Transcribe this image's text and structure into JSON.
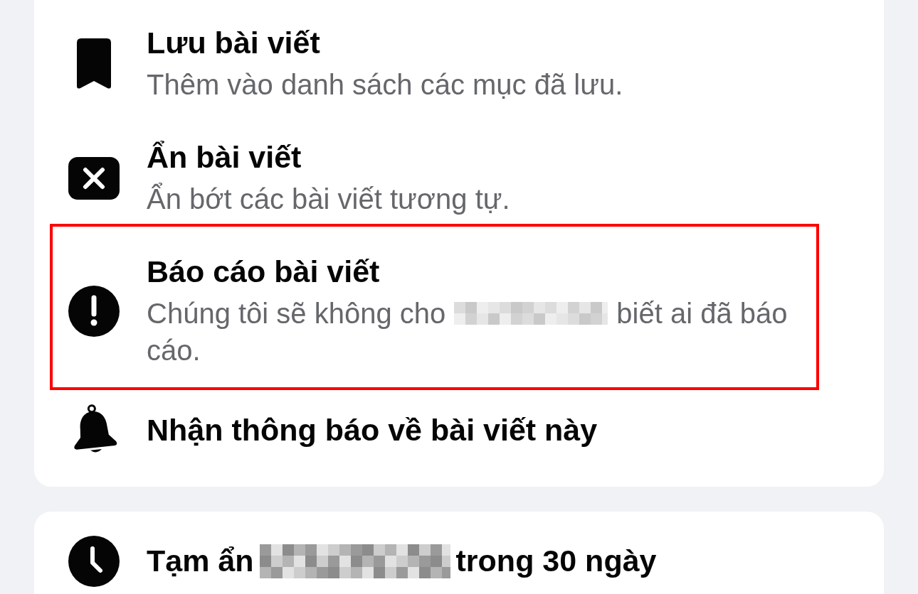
{
  "cards": [
    {
      "items": [
        {
          "title": [
            {
              "kind": "text",
              "text": "Lưu bài viết"
            }
          ],
          "description": [
            {
              "kind": "text",
              "text": "Thêm vào danh sách các mục đã lưu."
            }
          ],
          "highlighted": false
        },
        {
          "title": [
            {
              "kind": "text",
              "text": "Ẩn bài viết"
            }
          ],
          "description": [
            {
              "kind": "text",
              "text": "Ẩn bớt các bài viết tương tự."
            }
          ],
          "highlighted": false
        },
        {
          "title": [
            {
              "kind": "text",
              "text": "Báo cáo bài viết"
            }
          ],
          "description": [
            {
              "kind": "text",
              "text": "Chúng tôi sẽ không cho"
            },
            {
              "kind": "redacted"
            },
            {
              "kind": "text",
              "text": "biết ai đã báo"
            },
            {
              "kind": "text",
              "text": "cáo."
            }
          ],
          "highlighted": true
        },
        {
          "title": [
            {
              "kind": "text",
              "text": "Nhận thông báo về bài viết này"
            }
          ],
          "highlighted": false
        }
      ]
    },
    {
      "items": [
        {
          "title": [
            {
              "kind": "text",
              "text": "Tạm ẩn"
            },
            {
              "kind": "redacted"
            },
            {
              "kind": "text",
              "text": "trong 30 ngày"
            }
          ],
          "highlighted": false
        }
      ]
    }
  ]
}
